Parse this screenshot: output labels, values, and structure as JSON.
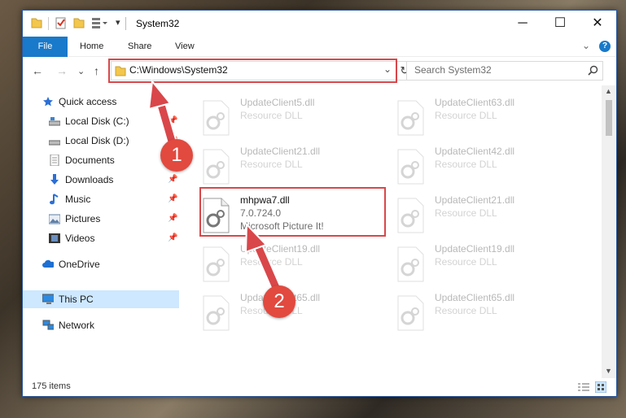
{
  "window": {
    "title": "System32",
    "controls": {
      "minimize": "─",
      "maximize": "☐",
      "close": "✕"
    }
  },
  "ribbon": {
    "tabs": [
      "File",
      "Home",
      "Share",
      "View"
    ],
    "help": "?",
    "expand": "⌄"
  },
  "nav": {
    "back": "←",
    "forward": "→",
    "recent": "⌄",
    "up": "↑",
    "address": "C:\\Windows\\System32",
    "address_dropdown": "⌄",
    "refresh": "↻",
    "search_placeholder": "Search System32"
  },
  "sidebar": {
    "items": [
      {
        "label": "Quick access",
        "icon": "star-icon",
        "pinned": false
      },
      {
        "label": "Local Disk (C:)",
        "icon": "drive-icon",
        "pinned": true
      },
      {
        "label": "Local Disk (D:)",
        "icon": "drive-icon",
        "pinned": true
      },
      {
        "label": "Documents",
        "icon": "documents-icon",
        "pinned": true
      },
      {
        "label": "Downloads",
        "icon": "downloads-icon",
        "pinned": true
      },
      {
        "label": "Music",
        "icon": "music-icon",
        "pinned": true
      },
      {
        "label": "Pictures",
        "icon": "pictures-icon",
        "pinned": true
      },
      {
        "label": "Videos",
        "icon": "videos-icon",
        "pinned": true
      },
      {
        "label": "OneDrive",
        "icon": "cloud-icon",
        "pinned": false
      },
      {
        "label": "This PC",
        "icon": "pc-icon",
        "pinned": false,
        "selected": true
      },
      {
        "label": "Network",
        "icon": "network-icon",
        "pinned": false
      }
    ]
  },
  "files": [
    {
      "name": "UpdateClient5.dll",
      "desc": "Resource DLL",
      "faded": true
    },
    {
      "name": "UpdateClient63.dll",
      "desc": "Resource DLL",
      "faded": true
    },
    {
      "name": "UpdateClient21.dll",
      "desc": "Resource DLL",
      "faded": true
    },
    {
      "name": "UpdateClient42.dll",
      "desc": "Resource DLL",
      "faded": true
    },
    {
      "name": "mhpwa7.dll",
      "version": "7.0.724.0",
      "desc": "Microsoft Picture It!",
      "faded": false
    },
    {
      "name": "UpdateClient21.dll",
      "desc": "Resource DLL",
      "faded": true
    },
    {
      "name": "UpdateClient19.dll",
      "desc": "Resource DLL",
      "faded": true
    },
    {
      "name": "UpdateClient19.dll",
      "desc": "Resource DLL",
      "faded": true
    },
    {
      "name": "UpdateClient65.dll",
      "desc": "Resource DLL",
      "faded": true
    },
    {
      "name": "UpdateClient65.dll",
      "desc": "Resource DLL",
      "faded": true
    }
  ],
  "status": {
    "item_count": "175 items"
  },
  "annotations": {
    "step1": "1",
    "step2": "2",
    "color": "#d9474a"
  }
}
